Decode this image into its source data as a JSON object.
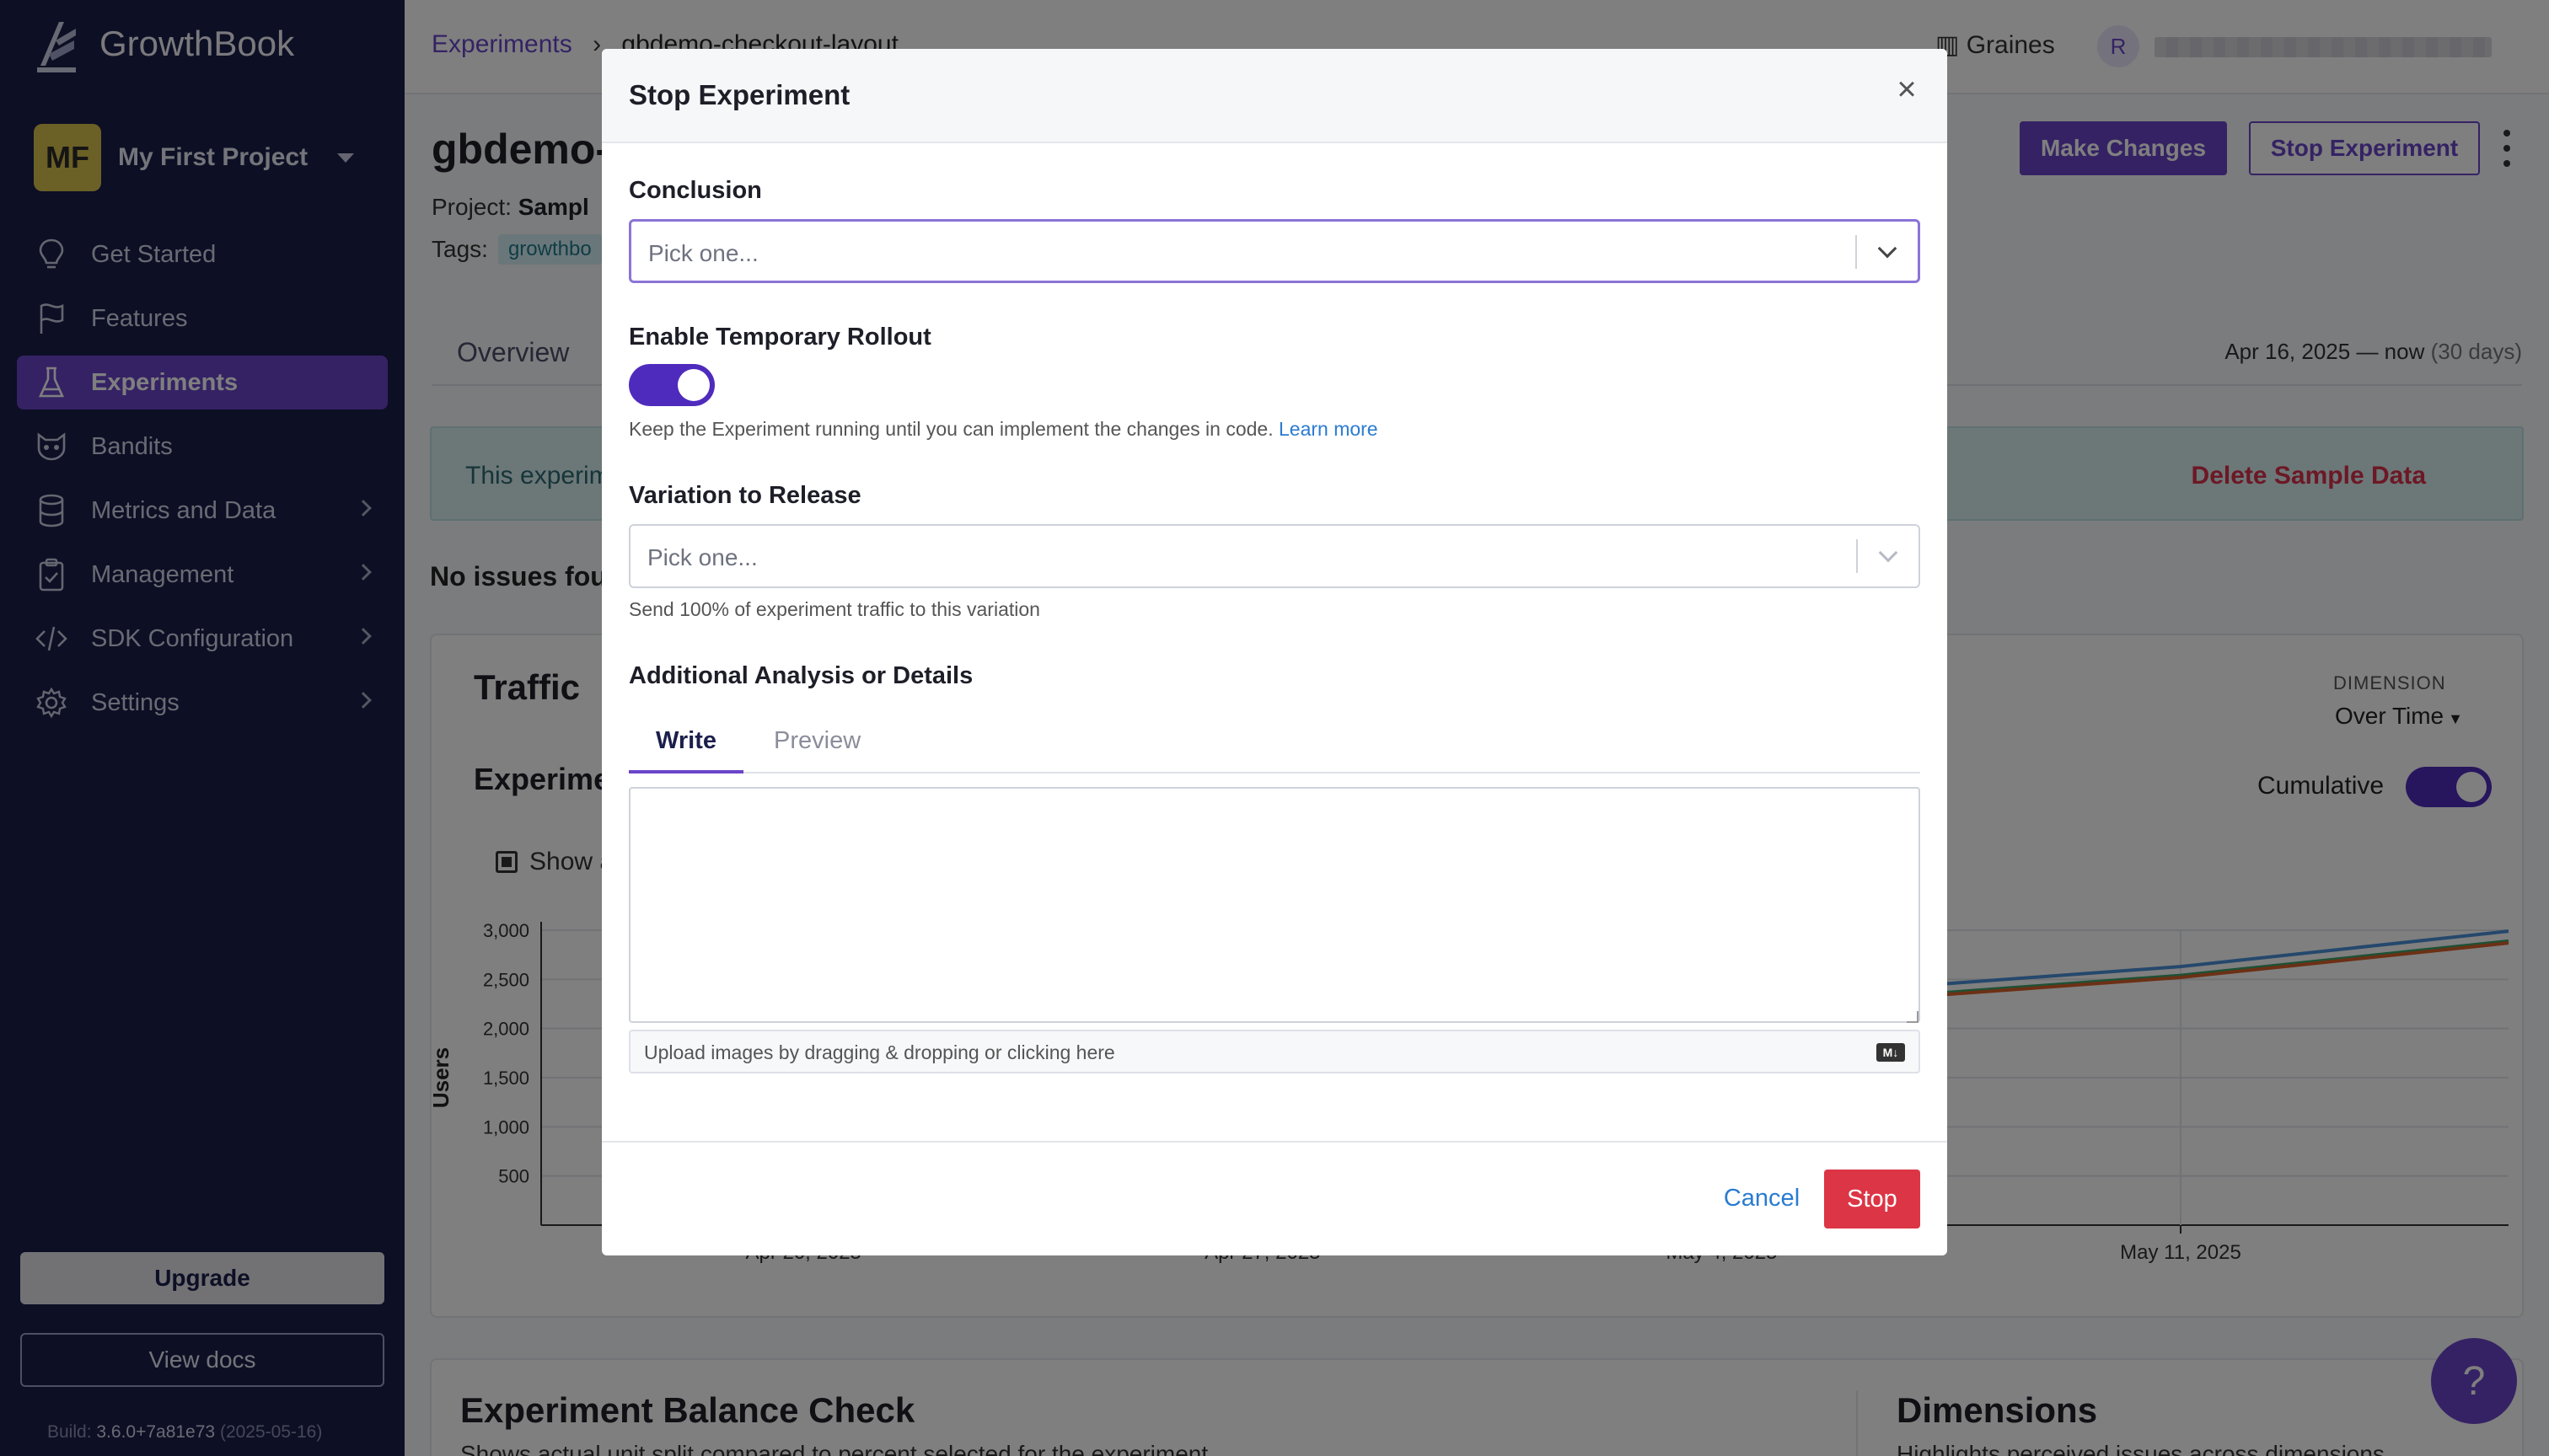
{
  "brand": {
    "name": "GrowthBook"
  },
  "project": {
    "initials": "MF",
    "name": "My First Project"
  },
  "nav": [
    {
      "label": "Get Started",
      "icon": "lightbulb-icon"
    },
    {
      "label": "Features",
      "icon": "flag-icon"
    },
    {
      "label": "Experiments",
      "icon": "flask-icon",
      "active": true
    },
    {
      "label": "Bandits",
      "icon": "raccoon-icon"
    },
    {
      "label": "Metrics and Data",
      "icon": "database-icon"
    },
    {
      "label": "Management",
      "icon": "clipboard-icon"
    },
    {
      "label": "SDK Configuration",
      "icon": "code-icon"
    },
    {
      "label": "Settings",
      "icon": "gear-icon"
    }
  ],
  "sidebar_footer": {
    "upgrade": "Upgrade",
    "docs": "View docs",
    "build_label": "Build:",
    "build_version": "3.6.0+7a81e73",
    "build_date": "(2025-05-16)"
  },
  "topbar": {
    "crumb_link": "Experiments",
    "crumb_sep": "›",
    "crumb_current": "gbdemo-checkout-layout",
    "org": "Graines",
    "user_initial": "R"
  },
  "experiment": {
    "title": "gbdemo-",
    "make_changes": "Make Changes",
    "stop_experiment": "Stop Experiment",
    "project_label": "Project:",
    "project_value": "Sampl",
    "tags_label": "Tags:",
    "tag": "growthbo",
    "tab_overview": "Overview",
    "date_range": "Apr 16, 2025 — now",
    "date_range_days": "(30 days)",
    "banner_text": "This experim",
    "delete_sample": "Delete Sample Data",
    "no_issues": "No issues fou"
  },
  "traffic": {
    "title": "Traffic",
    "subtitle": "Experime",
    "show_all": "Show a",
    "dimension_label": "DIMENSION",
    "dimension_value": "Over Time",
    "cumulative": "Cumulative"
  },
  "chart_data": {
    "type": "line",
    "title": "",
    "ylabel": "Users",
    "y_ticks": [
      "3,000",
      "2,500",
      "2,000",
      "1,500",
      "1,000",
      "500"
    ],
    "x_ticks": [
      "Apr 20, 2025",
      "Apr 27, 2025",
      "May 4, 2025",
      "May 11, 2025"
    ],
    "ylim": [
      0,
      3000
    ],
    "grid": true,
    "series": [
      {
        "color": "#4a90d9",
        "x": [
          "May 4, 2025",
          "May 11, 2025",
          "May 16, 2025"
        ],
        "values": [
          2290,
          2630,
          2990
        ]
      },
      {
        "color": "#3aa36b",
        "x": [
          "May 4, 2025",
          "May 11, 2025",
          "May 16, 2025"
        ],
        "values": [
          2200,
          2540,
          2890
        ]
      },
      {
        "color": "#d9602a",
        "x": [
          "May 4, 2025",
          "May 11, 2025",
          "May 16, 2025"
        ],
        "values": [
          2180,
          2520,
          2870
        ]
      }
    ]
  },
  "balance": {
    "title": "Experiment Balance Check",
    "subtitle": "Shows actual unit split compared to percent selected for the experiment",
    "dimensions_title": "Dimensions",
    "dimensions_subtitle": "Highlights perceived issues across dimensions"
  },
  "modal": {
    "title": "Stop Experiment",
    "close": "×",
    "conclusion_label": "Conclusion",
    "conclusion_placeholder": "Pick one...",
    "rollout_label": "Enable Temporary Rollout",
    "rollout_enabled": true,
    "rollout_help": "Keep the Experiment running until you can implement the changes in code.",
    "rollout_learn_more": "Learn more",
    "variation_label": "Variation to Release",
    "variation_placeholder": "Pick one...",
    "variation_help": "Send 100% of experiment traffic to this variation",
    "analysis_label": "Additional Analysis or Details",
    "tab_write": "Write",
    "tab_preview": "Preview",
    "analysis_value": "",
    "upload_hint": "Upload images by dragging & dropping or clicking here",
    "markdown_badge": "M↓",
    "cancel": "Cancel",
    "stop": "Stop"
  },
  "help_button": "?"
}
